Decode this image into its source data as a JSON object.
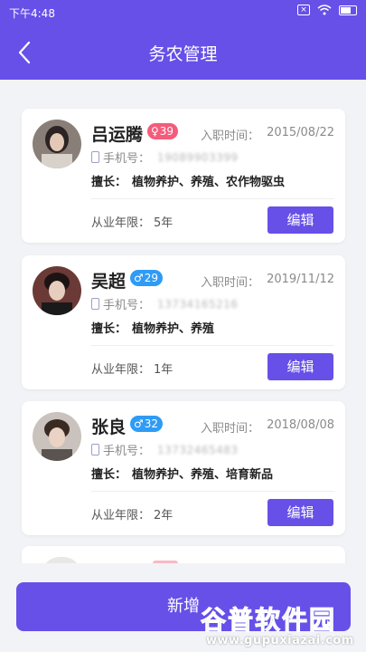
{
  "status_bar": {
    "time": "下午4:48",
    "x_icon_label": "×"
  },
  "nav": {
    "title": "务农管理",
    "back_icon": "chevron-left-icon"
  },
  "labels": {
    "hire_date": "入职时间：",
    "phone": "手机号：",
    "skill": "擅长：",
    "years": "从业年限：",
    "edit": "编辑"
  },
  "workers": [
    {
      "name": "吕运腾",
      "gender": "female",
      "gender_symbol": "♀",
      "age": "39",
      "hire_date": "2015/08/22",
      "phone": "19089903399",
      "skills": "植物养护、养殖、农作物驱虫",
      "years": "5年"
    },
    {
      "name": "吴超",
      "gender": "male",
      "gender_symbol": "♂",
      "age": "29",
      "hire_date": "2019/11/12",
      "phone": "13734165216",
      "skills": "植物养护、养殖",
      "years": "1年"
    },
    {
      "name": "张良",
      "gender": "male",
      "gender_symbol": "♂",
      "age": "32",
      "hire_date": "2018/08/08",
      "phone": "13732465483",
      "skills": "植物养护、养殖、培育新品",
      "years": "2年"
    }
  ],
  "add_button": {
    "label": "新增"
  },
  "watermark": {
    "main": "谷普软件园",
    "url": "www.gupuxiazai.com"
  },
  "colors": {
    "primary": "#6650e8",
    "female_badge": "#f55b7b",
    "male_badge": "#2f9bf5",
    "background": "#f2f3f7"
  }
}
